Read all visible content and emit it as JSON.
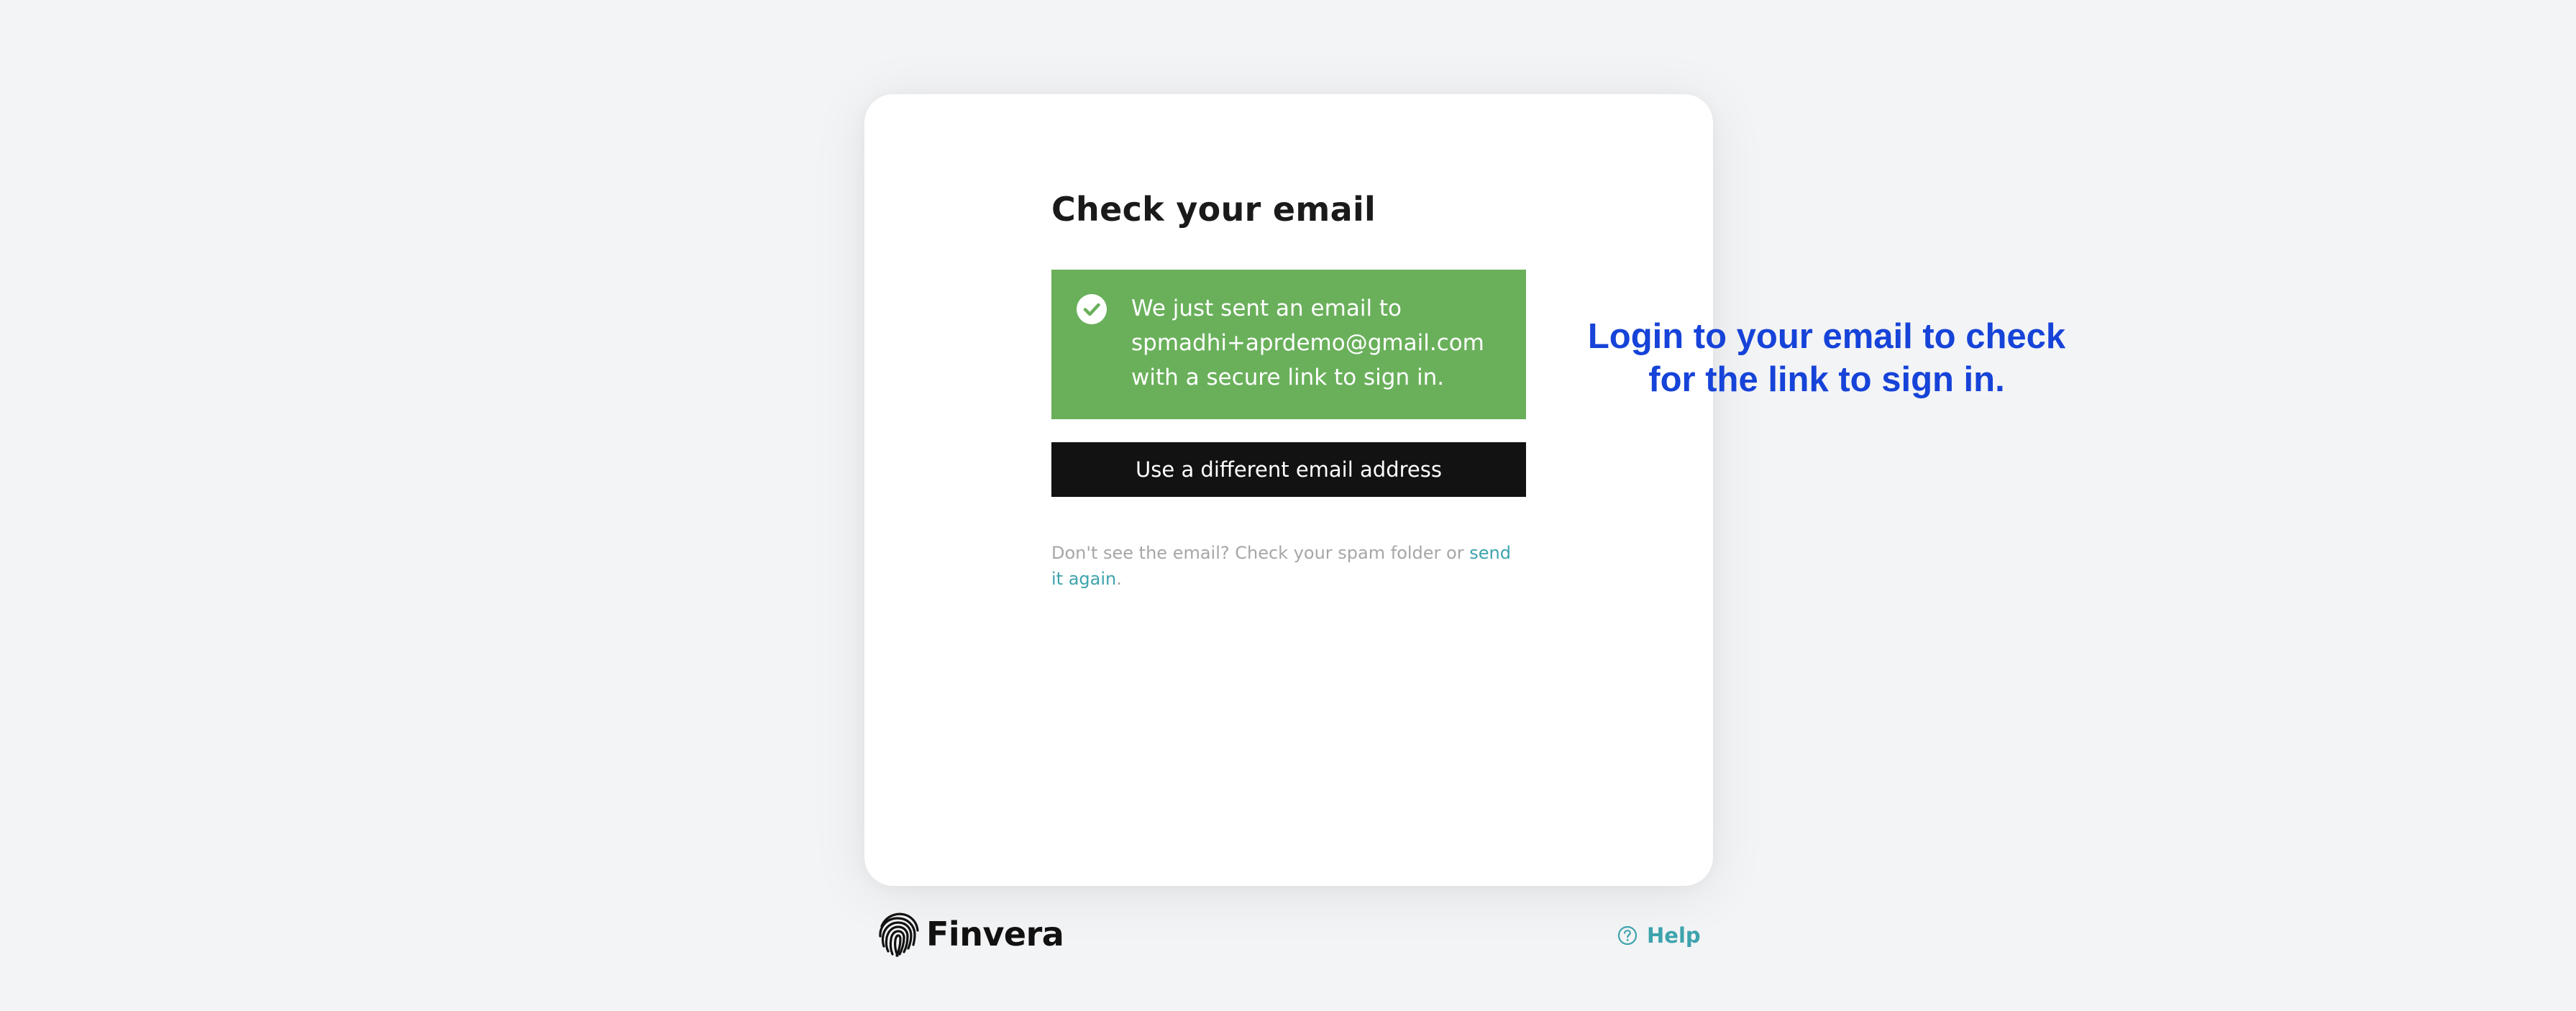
{
  "page": {
    "title": "Check your email",
    "alert": {
      "icon": "check-circle-icon",
      "lines": [
        "We just sent an email to",
        "spmadhi+aprdemo@gmail.com",
        "with a secure link to sign in."
      ],
      "color": "#6ab05b"
    },
    "button_label": "Use a different email address",
    "hint": {
      "text": "Don't see the email? Check your spam folder or ",
      "link": "send it again",
      "end": "."
    }
  },
  "footer": {
    "brand": "Finvera",
    "help_label": "Help",
    "help_icon": "question-circle-icon",
    "accent": "#3da3ad"
  },
  "annotation": {
    "lines": [
      "Login to your email to check",
      "for the link to sign in."
    ],
    "color": "#1643d8"
  }
}
